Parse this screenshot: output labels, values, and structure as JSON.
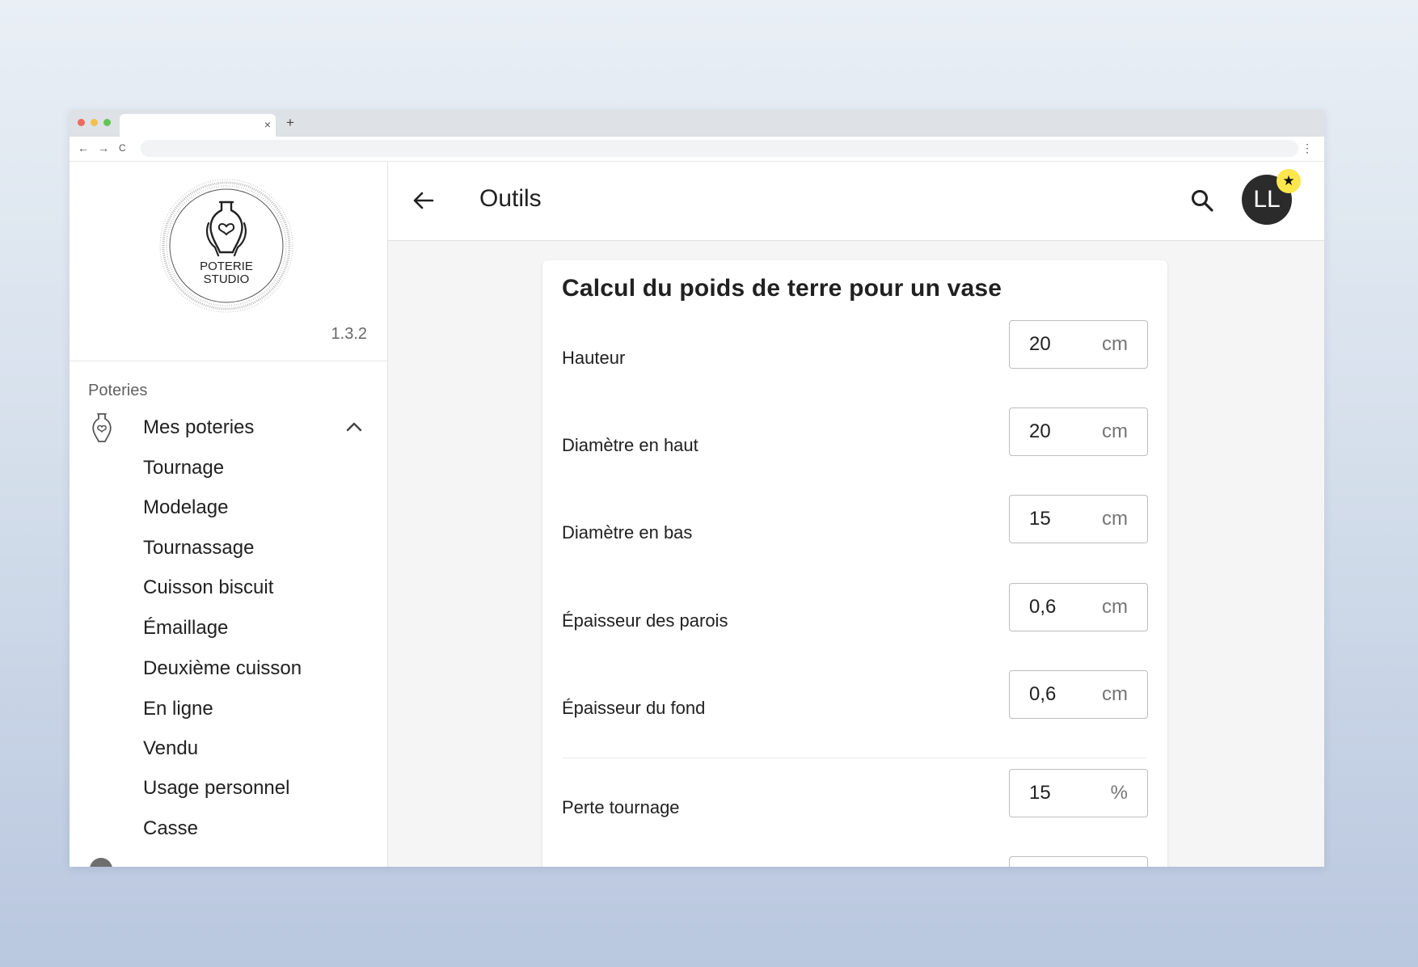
{
  "browser": {
    "tab_close": "×",
    "new_tab": "+",
    "back": "←",
    "forward": "→",
    "reload": "C",
    "menu": "⋮"
  },
  "sidebar": {
    "logo_text_line1": "POTERIE",
    "logo_text_line2": "STUDIO",
    "version": "1.3.2",
    "section_label": "Poteries",
    "parent_item": {
      "label": "Mes poteries",
      "icon": "vase-icon",
      "expanded": true
    },
    "items": [
      "Tournage",
      "Modelage",
      "Tournassage",
      "Cuisson biscuit",
      "Émaillage",
      "Deuxième cuisson",
      "En ligne",
      "Vendu",
      "Usage personnel",
      "Casse"
    ]
  },
  "appbar": {
    "title": "Outils",
    "avatar_initials": "LL",
    "avatar_badge": "★"
  },
  "calculator": {
    "title": "Calcul du poids de terre pour un vase",
    "rows": [
      {
        "label": "Hauteur",
        "value": "20",
        "unit": "cm"
      },
      {
        "label": "Diamètre en haut",
        "value": "20",
        "unit": "cm"
      },
      {
        "label": "Diamètre en bas",
        "value": "15",
        "unit": "cm"
      },
      {
        "label": "Épaisseur des parois",
        "value": "0,6",
        "unit": "cm"
      },
      {
        "label": "Épaisseur du fond",
        "value": "0,6",
        "unit": "cm"
      },
      {
        "label": "Perte tournage",
        "value": "15",
        "unit": "%"
      }
    ]
  },
  "colors": {
    "avatar_bg": "#2b2b2b",
    "badge": "#fde74c",
    "content_bg": "#f5f5f5"
  }
}
